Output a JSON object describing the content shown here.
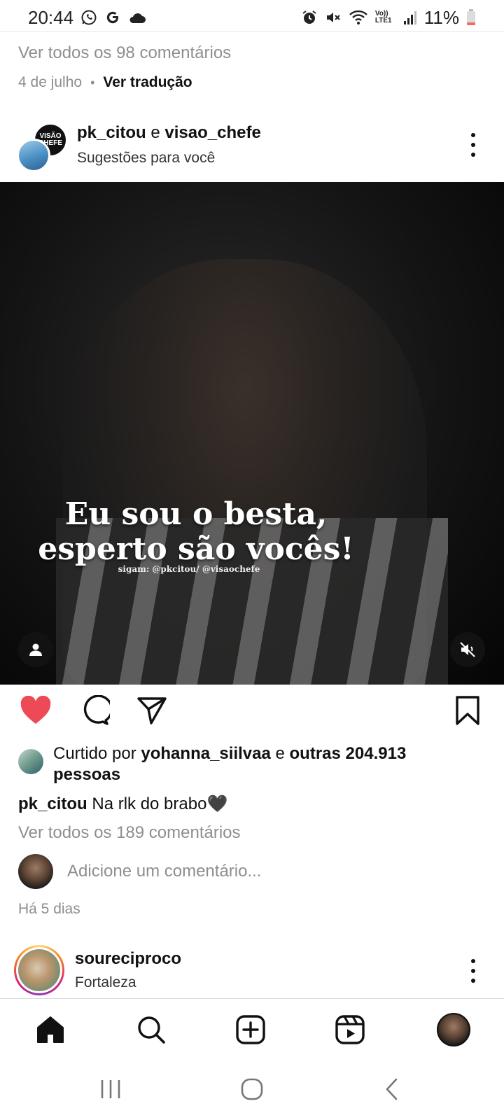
{
  "status_bar": {
    "time": "20:44",
    "battery": "11%",
    "network_label": "Vo)) LTE1",
    "icons": [
      "whatsapp-icon",
      "google-icon",
      "cloud-icon",
      "alarm-icon",
      "mute-icon",
      "wifi-icon",
      "signal-icon",
      "battery-icon"
    ]
  },
  "previous_post": {
    "view_comments": "Ver todos os 98 comentários",
    "date": "4 de julho",
    "separator": "•",
    "translate": "Ver tradução"
  },
  "post": {
    "user1": "pk_citou",
    "joiner": " e ",
    "user2": "visao_chefe",
    "subtitle": "Sugestões para você",
    "collab_avatar_text": "VISÃO CHEFE",
    "media": {
      "caption_line1": "Eu sou o besta,",
      "caption_line2": "esperto são vocês!",
      "credit": "sigam: @pkcitou/ @visaochefe"
    },
    "liked_by_prefix": "Curtido por ",
    "liked_by_user": "yohanna_siilvaa",
    "liked_by_joiner": " e ",
    "liked_by_others": "outras 204.913",
    "liked_by_suffix": "pessoas",
    "caption_user": "pk_citou",
    "caption_text": " Na rlk do brabo🖤",
    "view_comments": "Ver todos os 189 comentários",
    "add_comment_placeholder": "Adicione um comentário...",
    "time_ago": "Há 5 dias",
    "liked": true,
    "like_color": "#ed4956"
  },
  "next_post": {
    "username": "soureciproco",
    "location": "Fortaleza"
  },
  "bottom_nav": [
    "home-icon",
    "search-icon",
    "add-post-icon",
    "reels-icon",
    "profile-avatar"
  ],
  "system_nav": [
    "recent-apps",
    "home",
    "back"
  ]
}
